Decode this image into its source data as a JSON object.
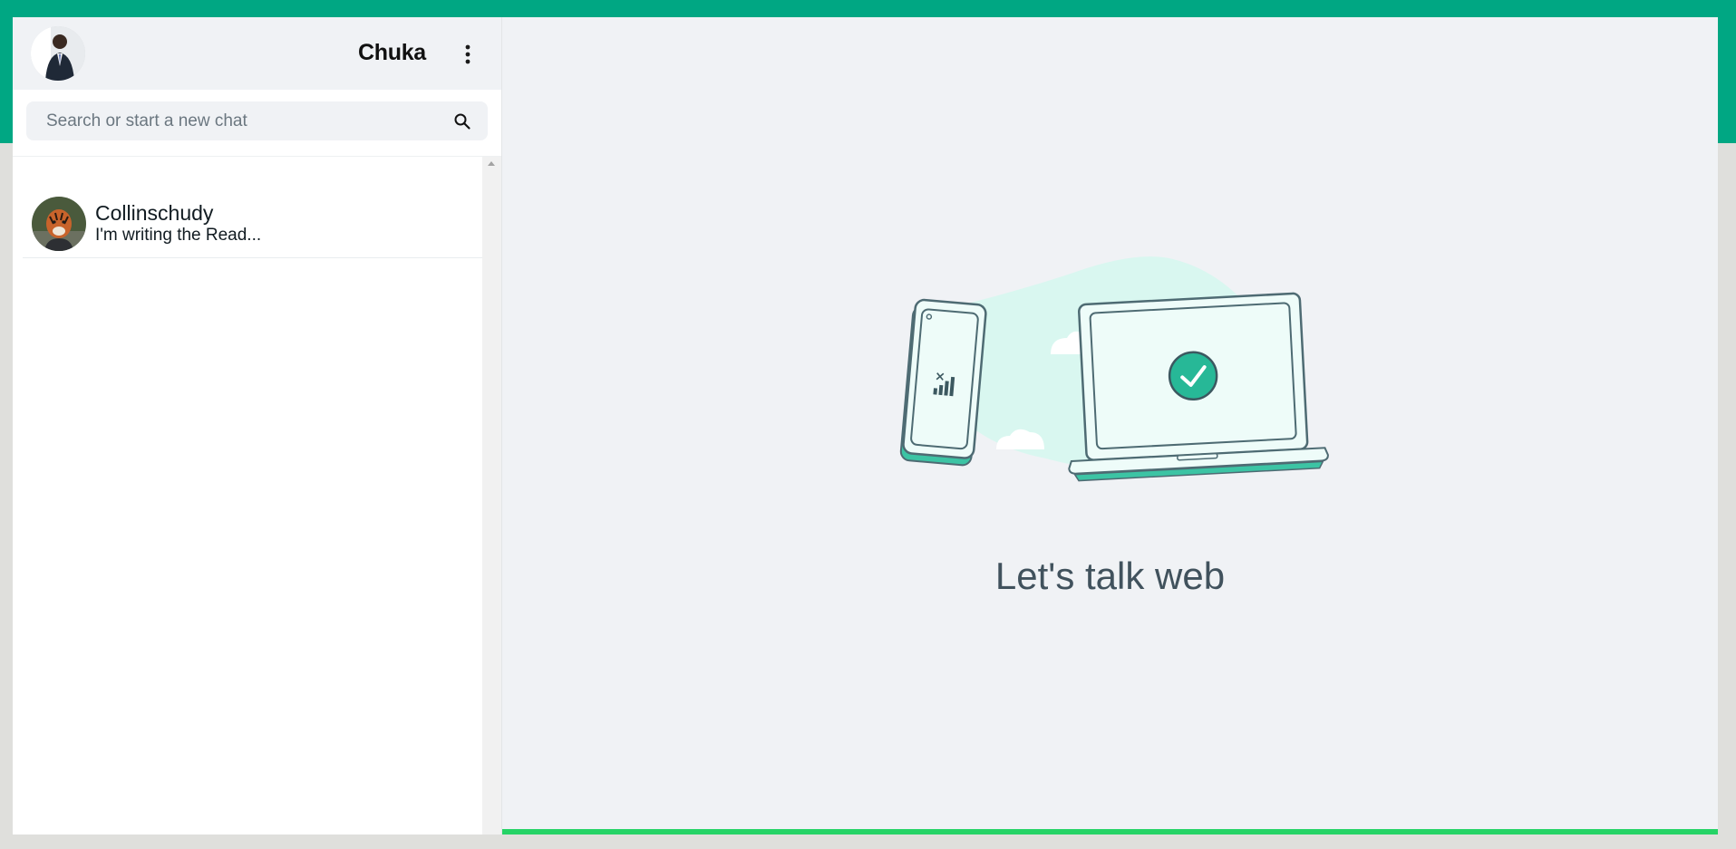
{
  "header": {
    "user_name": "Chuka",
    "avatar_icon": "person-avatar",
    "menu_icon": "kebab-menu-icon"
  },
  "search": {
    "placeholder": "Search or start a new chat",
    "icon": "search-icon"
  },
  "chats": [
    {
      "name": "Collinschudy",
      "preview": "I'm writing the Read...",
      "avatar_icon": "tiger-avatar"
    }
  ],
  "main": {
    "title": "Let's talk web",
    "illustration": "phone-laptop-connection"
  },
  "colors": {
    "brand_band": "#00a783",
    "accent_bar": "#25d366",
    "panel_bg": "#f0f2f5",
    "title_text": "#41525d"
  }
}
